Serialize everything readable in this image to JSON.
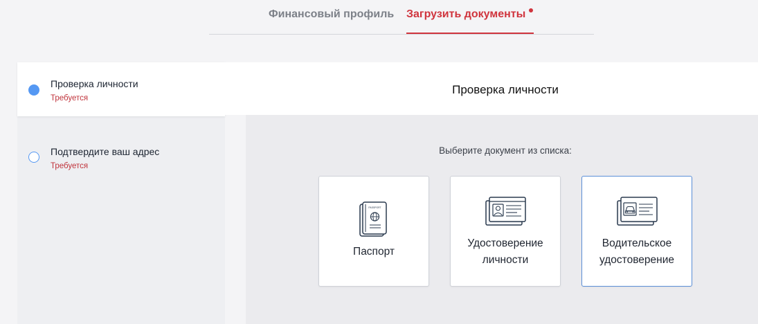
{
  "tabs": [
    {
      "label": "Финансовый профиль",
      "active": false
    },
    {
      "label": "Загрузить документы",
      "active": true,
      "has_notification": true
    }
  ],
  "steps": [
    {
      "title": "Проверка личности",
      "status": "Требуется",
      "active": true
    },
    {
      "title": "Подтвердите ваш адрес",
      "status": "Требуется",
      "active": false
    }
  ],
  "main": {
    "title": "Проверка личности",
    "prompt": "Выберите документ из списка:",
    "documents": [
      {
        "label": "Паспорт",
        "icon": "passport-icon",
        "passport_text": "PASSPORT"
      },
      {
        "label_line1": "Удостоверение",
        "label_line2": "личности",
        "icon": "id-card-icon"
      },
      {
        "label_line1": "Водительское",
        "label_line2": "удостоверение",
        "icon": "driver-license-icon",
        "selected": true
      }
    ]
  },
  "colors": {
    "accent_red": "#d0343d",
    "accent_blue": "#5598f3",
    "background": "#f4f4f6",
    "panel_gray": "#ebebee"
  }
}
